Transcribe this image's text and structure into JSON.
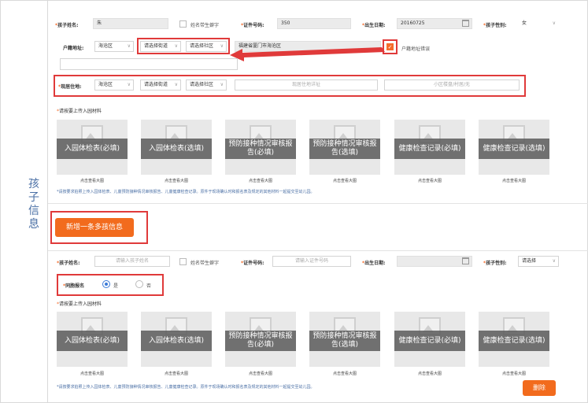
{
  "section_title": [
    "孩",
    "子",
    "信",
    "息"
  ],
  "child1": {
    "name_label": "孩子姓名:",
    "name_value": "朱",
    "not_self_label": "姓名带生僻字",
    "id_label": "证件号码:",
    "id_value": "350",
    "birth_label": "出生日期:",
    "birth_value": "20160725",
    "gender_label": "孩子性别:",
    "gender_value": "女",
    "hukou_label": "户籍地址:",
    "hukou_district": "海沧区",
    "hukou_street": "请选择街道",
    "hukou_community": "请选择社区",
    "hukou_detail": "福建省厦门市海沧区",
    "hukou_wrong_label": "户籍地址错误",
    "current_label": "现居住地:",
    "current_district": "海沧区",
    "current_street": "请选择街道",
    "current_community": "请选择社区",
    "current_address_ph": "现居住地详址",
    "current_estate_ph": "小区楼盘/村居/无",
    "upload_label": "请按要上传入园材料",
    "cards": [
      {
        "label": "入园体检表(必填)",
        "caption": "点击查看大图"
      },
      {
        "label": "入园体检表(选填)",
        "caption": "点击查看大图"
      },
      {
        "label": "预防接种情况审核报告(必填)",
        "caption": "点击查看大图"
      },
      {
        "label": "预防接种情况审核报告(选填)",
        "caption": "点击查看大图"
      },
      {
        "label": "健康检查记录(必填)",
        "caption": "点击查看大图"
      },
      {
        "label": "健康检查记录(选填)",
        "caption": "点击查看大图"
      }
    ],
    "note": "*请按要求拍照上传入园体检表、儿童预防接种情况审核报告、儿童健康检查记录。原件于现场确认时和报名表及规定的其他材料一起提交至幼儿园。"
  },
  "add_child_button": "新增一条多孩信息",
  "child2": {
    "name_label": "孩子姓名:",
    "name_ph": "请输入孩子姓名",
    "not_self_label": "姓名带生僻字",
    "id_label": "证件号码:",
    "id_ph": "请输入证件号码",
    "birth_label": "出生日期:",
    "gender_label": "孩子性别:",
    "gender_value": "请选择",
    "twins_label": "同胞报名",
    "twins_yes": "是",
    "twins_no": "否",
    "upload_label": "请按要上传入园材料",
    "cards": [
      {
        "label": "入园体检表(必填)",
        "caption": "点击查看大图"
      },
      {
        "label": "入园体检表(选填)",
        "caption": "点击查看大图"
      },
      {
        "label": "预防接种情况审核报告(必填)",
        "caption": "点击查看大图"
      },
      {
        "label": "预防接种情况审核报告(选填)",
        "caption": "点击查看大图"
      },
      {
        "label": "健康检查记录(必填)",
        "caption": "点击查看大图"
      },
      {
        "label": "健康检查记录(选填)",
        "caption": "点击查看大图"
      }
    ],
    "note": "*请按要求拍照上传入园体检表、儿童预防接种情况审核报告、儿童健康检查记录。原件于现场确认时和报名表及规定的其他材料一起提交至幼儿园。",
    "delete_button": "删除"
  },
  "colors": {
    "accent": "#f26b1d",
    "highlight": "#e03a3a",
    "title": "#4a6fa5",
    "radio": "#3b7bd8"
  }
}
